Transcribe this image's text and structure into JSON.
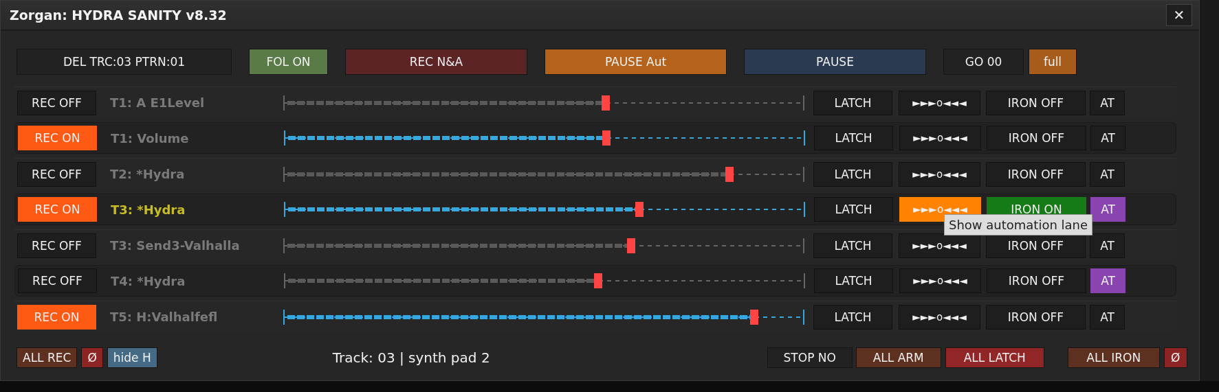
{
  "window": {
    "title": "Zorgan: HYDRA SANITY v8.32",
    "close": "✕"
  },
  "toolbar": [
    {
      "label": "DEL TRC:03 PTRN:01",
      "color": "#222222"
    },
    {
      "label": "FOL ON",
      "color": "#5a7a48"
    },
    {
      "label": "REC N&A",
      "color": "#5c2424"
    },
    {
      "label": "PAUSE Aut",
      "color": "#b5621a"
    },
    {
      "label": "PAUSE",
      "color": "#2a3a50"
    },
    {
      "label": "GO 00",
      "color": "#222222"
    },
    {
      "label": "full",
      "color": "#a85c1c"
    }
  ],
  "rows": [
    {
      "rec": "REC OFF",
      "rec_on": false,
      "name": "T1: A E1Level",
      "active": false,
      "framed": false,
      "level": 0.62,
      "latch": "LATCH",
      "lane": "►►►o◄◄◄",
      "lane_on": false,
      "iron": "IRON OFF",
      "iron_on": false,
      "at": "AT",
      "at_on": false
    },
    {
      "rec": "REC ON",
      "rec_on": true,
      "name": "T1: Volume",
      "active": false,
      "framed": true,
      "level": 0.62,
      "latch": "LATCH",
      "lane": "►►►o◄◄◄",
      "lane_on": false,
      "iron": "IRON OFF",
      "iron_on": false,
      "at": "AT",
      "at_on": false
    },
    {
      "rec": "REC OFF",
      "rec_on": false,
      "name": "T2: *Hydra",
      "active": false,
      "framed": false,
      "level": 0.858,
      "latch": "LATCH",
      "lane": "►►►o◄◄◄",
      "lane_on": false,
      "iron": "IRON OFF",
      "iron_on": false,
      "at": "AT",
      "at_on": false
    },
    {
      "rec": "REC ON",
      "rec_on": true,
      "name": "T3: *Hydra",
      "active": true,
      "framed": true,
      "level": 0.683,
      "latch": "LATCH",
      "lane": "►►►o◄◄◄",
      "lane_on": true,
      "iron": "IRON ON",
      "iron_on": true,
      "at": "AT",
      "at_on": true
    },
    {
      "rec": "REC OFF",
      "rec_on": false,
      "name": "T3: Send3-Valhalla",
      "active": false,
      "framed": false,
      "level": 0.668,
      "latch": "LATCH",
      "lane": "►►►o◄◄◄",
      "lane_on": false,
      "iron": "IRON OFF",
      "iron_on": false,
      "at": "AT",
      "at_on": false
    },
    {
      "rec": "REC OFF",
      "rec_on": false,
      "name": "T4: *Hydra",
      "active": false,
      "framed": true,
      "level": 0.603,
      "latch": "LATCH",
      "lane": "►►►o◄◄◄",
      "lane_on": false,
      "iron": "IRON OFF",
      "iron_on": false,
      "at": "AT",
      "at_on": true
    },
    {
      "rec": "REC ON",
      "rec_on": true,
      "name": "T5: H:Valhalfefl",
      "active": false,
      "framed": false,
      "level": 0.906,
      "latch": "LATCH",
      "lane": "►►►o◄◄◄",
      "lane_on": false,
      "iron": "IRON OFF",
      "iron_on": false,
      "at": "AT",
      "at_on": false
    }
  ],
  "tooltip": "Show automation lane",
  "bottom_left": [
    {
      "label": "ALL REC",
      "color": "#5e3020"
    },
    {
      "label": "Ø",
      "color": "#8c2424"
    },
    {
      "label": "hide H",
      "color": "#456a86"
    }
  ],
  "status": "Track: 03 | synth pad 2",
  "bottom_right": [
    {
      "label": "STOP NO",
      "color": "#222222"
    },
    {
      "label": "ALL ARM",
      "color": "#5e3020"
    },
    {
      "label": "ALL LATCH",
      "color": "#922626"
    },
    {
      "label": "ALL IRON",
      "color": "#5e3020"
    },
    {
      "label": "Ø",
      "color": "#8c2424"
    }
  ]
}
